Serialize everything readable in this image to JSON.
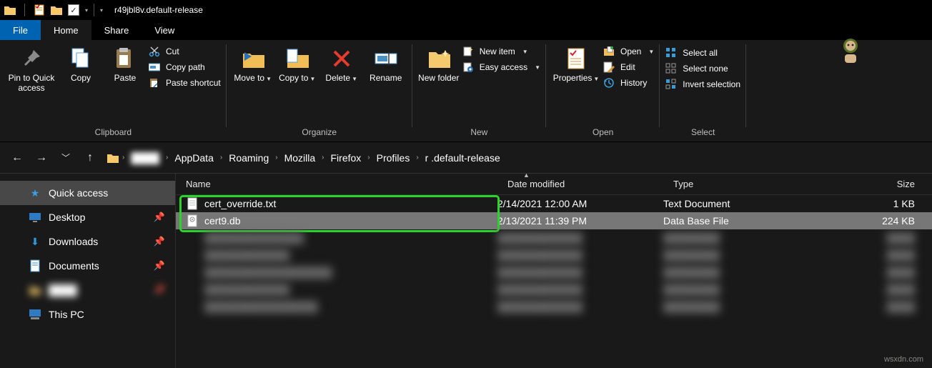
{
  "window": {
    "title": "r49jbl8v.default-release"
  },
  "tabs": {
    "file": "File",
    "home": "Home",
    "share": "Share",
    "view": "View"
  },
  "ribbon": {
    "clipboard": {
      "pin": "Pin to Quick access",
      "copy": "Copy",
      "paste": "Paste",
      "cut": "Cut",
      "copy_path": "Copy path",
      "paste_shortcut": "Paste shortcut",
      "label": "Clipboard"
    },
    "organize": {
      "move_to": "Move to",
      "copy_to": "Copy to",
      "delete": "Delete",
      "rename": "Rename",
      "label": "Organize"
    },
    "new": {
      "new_folder": "New folder",
      "new_item": "New item",
      "easy_access": "Easy access",
      "label": "New"
    },
    "open": {
      "properties": "Properties",
      "open": "Open",
      "edit": "Edit",
      "history": "History",
      "label": "Open"
    },
    "select": {
      "select_all": "Select all",
      "select_none": "Select none",
      "invert": "Invert selection",
      "label": "Select"
    }
  },
  "breadcrumb": {
    "items": [
      "",
      "AppData",
      "Roaming",
      "Mozilla",
      "Firefox",
      "Profiles",
      "r         .default-release"
    ]
  },
  "sidebar": {
    "quick_access": "Quick access",
    "desktop": "Desktop",
    "downloads": "Downloads",
    "documents": "Documents",
    "hidden": "——",
    "this_pc": "This PC"
  },
  "columns": {
    "name": "Name",
    "date": "Date modified",
    "type": "Type",
    "size": "Size"
  },
  "files": [
    {
      "name": "cert_override.txt",
      "date": "2/14/2021 12:00 AM",
      "type": "Text Document",
      "size": "1 KB",
      "selected": false
    },
    {
      "name": "cert9.db",
      "date": "2/13/2021 11:39 PM",
      "type": "Data Base File",
      "size": "224 KB",
      "selected": true
    }
  ],
  "watermark": "wsxdn.com"
}
